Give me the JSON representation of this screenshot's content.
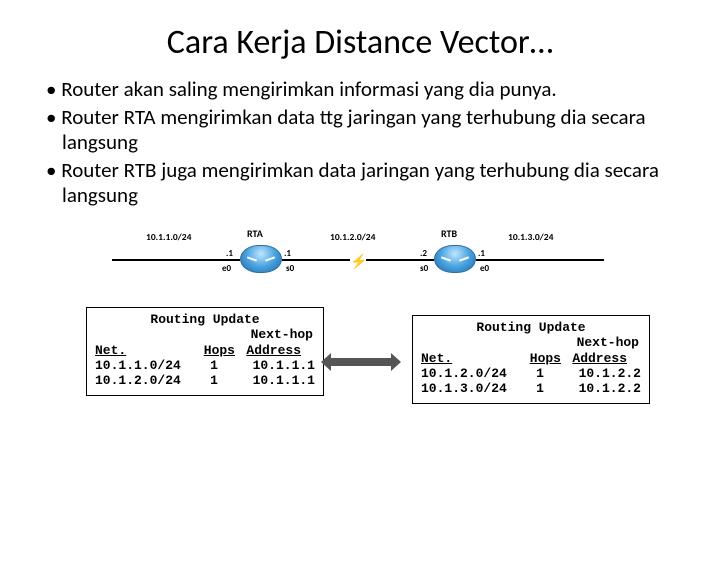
{
  "title": "Cara Kerja Distance Vector…",
  "bullets": [
    "Router akan saling mengirimkan informasi yang dia punya.",
    "Router RTA mengirimkan data ttg jaringan yang terhubung dia secara langsung",
    "Router RTB juga mengirimkan data jaringan yang terhubung dia secara langsung"
  ],
  "diagram": {
    "routers": [
      {
        "name": "RTA"
      },
      {
        "name": "RTB"
      }
    ],
    "networks": {
      "left": "10.1.1.0/24",
      "middle": "10.1.2.0/24",
      "right": "10.1.3.0/24"
    },
    "interfaces": {
      "rta_e0": "e0",
      "rta_s0": "s0",
      "rtb_s0": "s0",
      "rtb_e0": "e0"
    },
    "host_addr": {
      "rta_e0": ".1",
      "rta_s0": ".1",
      "rtb_s0": ".2",
      "rtb_e0": ".1"
    }
  },
  "tables": {
    "header": "Routing Update",
    "nexthop": "Next-hop",
    "col_net": "Net.",
    "col_hops": "Hops",
    "col_addr": "Address",
    "left": {
      "rows": [
        {
          "net": "10.1.1.0/24",
          "hops": "1",
          "addr": "10.1.1.1"
        },
        {
          "net": "10.1.2.0/24",
          "hops": "1",
          "addr": "10.1.1.1"
        }
      ]
    },
    "right": {
      "rows": [
        {
          "net": "10.1.2.0/24",
          "hops": "1",
          "addr": "10.1.2.2"
        },
        {
          "net": "10.1.3.0/24",
          "hops": "1",
          "addr": "10.1.2.2"
        }
      ]
    }
  }
}
